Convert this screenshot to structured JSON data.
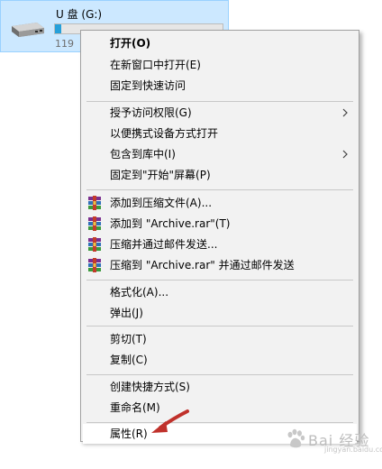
{
  "drive": {
    "name": "U 盘 (G:)",
    "size_text": "119",
    "usage_fraction": 0.04
  },
  "menu": {
    "open": "打开(O)",
    "open_new_window": "在新窗口中打开(E)",
    "pin_quick_access": "固定到快速访问",
    "grant_access": "授予访问权限(G)",
    "open_portable": "以便携式设备方式打开",
    "include_library": "包含到库中(I)",
    "pin_start": "固定到\"开始\"屏幕(P)",
    "add_archive": "添加到压缩文件(A)...",
    "add_archive_rar": "添加到 \"Archive.rar\"(T)",
    "compress_email": "压缩并通过邮件发送...",
    "compress_rar_email": "压缩到 \"Archive.rar\" 并通过邮件发送",
    "format": "格式化(A)...",
    "eject": "弹出(J)",
    "cut": "剪切(T)",
    "copy": "复制(C)",
    "create_shortcut": "创建快捷方式(S)",
    "rename": "重命名(M)",
    "properties": "属性(R)"
  },
  "watermark": {
    "text": "Bai 经验",
    "sub": "jingyan.baidu.com"
  },
  "colors": {
    "selection": "#cce8ff",
    "bar_fill": "#26a0da",
    "arrow": "#c0312b",
    "menu_bg": "#f2f2f2"
  }
}
